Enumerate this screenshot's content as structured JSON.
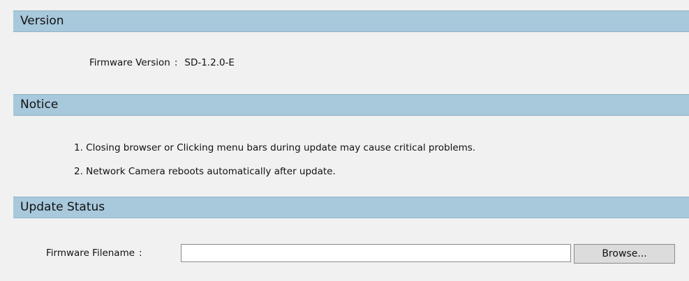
{
  "version_section": {
    "title": "Version",
    "firmware_label": "Firmware Version",
    "separator": ":",
    "firmware_value": "SD-1.2.0-E"
  },
  "notice_section": {
    "title": "Notice",
    "items": [
      "1. Closing browser or Clicking menu bars during update may cause critical problems.",
      "2. Network Camera reboots automatically after update."
    ]
  },
  "update_section": {
    "title": "Update Status",
    "filename_label": "Firmware Filename",
    "separator": ":",
    "filename_value": "",
    "browse_label": "Browse..."
  }
}
